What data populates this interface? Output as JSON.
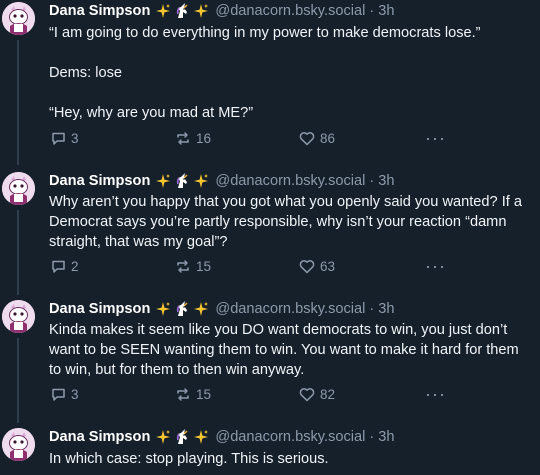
{
  "author": {
    "name": "Dana Simpson",
    "handle": "@danacorn.bsky.social",
    "badge_icons": [
      "sparkles-icon",
      "unicorn-icon",
      "sparkles-icon"
    ]
  },
  "separator": "·",
  "posts": [
    {
      "time": "3h",
      "lines": [
        "“I am going to do everything in my power to make democrats lose.”",
        "",
        "Dems: lose",
        "",
        "“Hey, why are you mad at ME?”"
      ],
      "replies": "3",
      "reposts": "16",
      "likes": "86"
    },
    {
      "time": "3h",
      "lines": [
        "Why aren’t you happy that you got what you openly said you wanted? If a Democrat says you’re partly responsible, why isn’t your reaction “damn straight, that was my goal”?"
      ],
      "replies": "2",
      "reposts": "15",
      "likes": "63"
    },
    {
      "time": "3h",
      "lines": [
        "Kinda makes it seem like you DO want democrats to win, you just don’t want to be SEEN wanting them to win. You want to make it hard for them to win, but for them to then win anyway."
      ],
      "replies": "3",
      "reposts": "15",
      "likes": "82"
    },
    {
      "time": "3h",
      "lines": [
        "In which case: stop playing. This is serious."
      ]
    }
  ],
  "more_label": "···",
  "colors": {
    "background": "#16202a",
    "muted": "#8c9aab",
    "text": "#f1f5f9",
    "thread_line": "#2f3d4d"
  }
}
